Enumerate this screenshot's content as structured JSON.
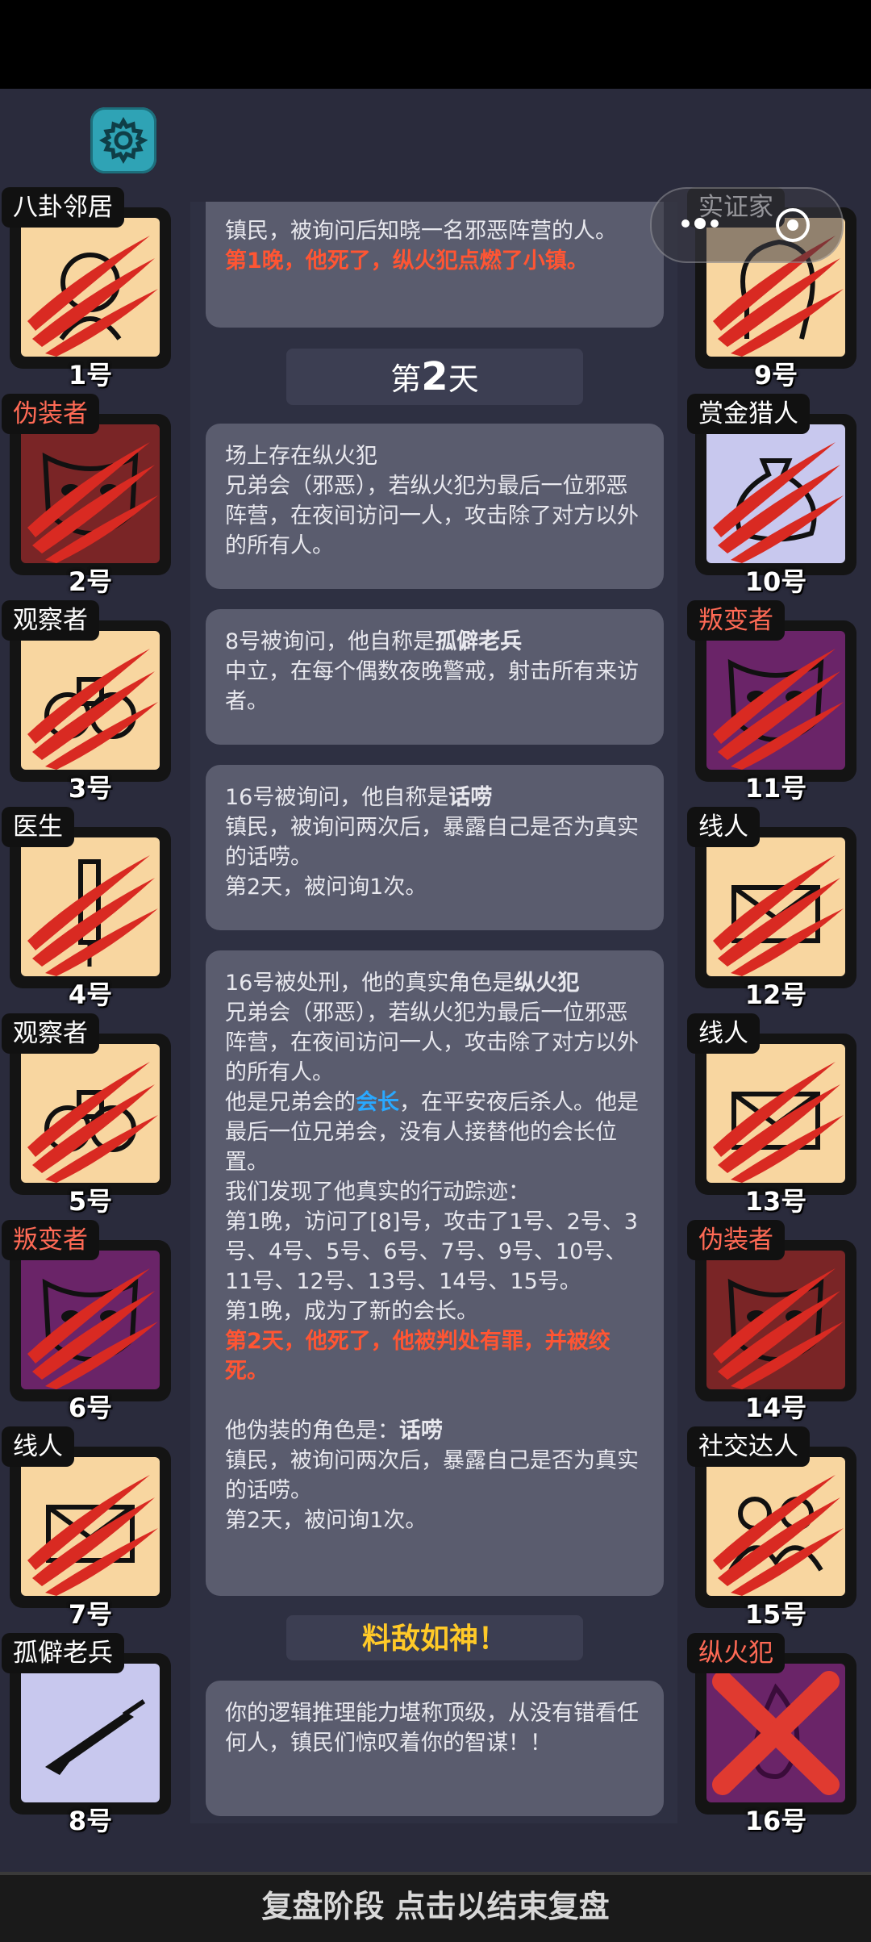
{
  "settings": {
    "icon": "gear-icon"
  },
  "log": {
    "partial_text": "镇民，被询问后知晓一名邪恶阵营的人。",
    "partial_red": "第1晚，他死了，纵火犯点燃了小镇。",
    "day_prefix": "第",
    "day_num": "2",
    "day_suffix": "天",
    "card1": "场上存在纵火犯\n兄弟会（邪恶），若纵火犯为最后一位邪恶阵营，在夜间访问一人，攻击除了对方以外的所有人。",
    "card2_a": "8号被询问，他自称是",
    "card2_b": "孤僻老兵",
    "card2_c": "\n中立，在每个偶数夜晚警戒，射击所有来访者。",
    "card3_a": "16号被询问，他自称是",
    "card3_b": "话唠",
    "card3_c": "\n镇民，被询问两次后，暴露自己是否为真实的话唠。\n第2天，被问询1次。",
    "card4_a": "16号被处刑，他的真实角色是",
    "card4_b": "纵火犯",
    "card4_c": "\n兄弟会（邪恶），若纵火犯为最后一位邪恶阵营，在夜间访问一人，攻击除了对方以外的所有人。\n他是兄弟会的",
    "card4_d": "会长",
    "card4_e": "，在平安夜后杀人。他是最后一位兄弟会，没有人接替他的会长位置。\n我们发现了他真实的行动踪迹：\n第1晚，访问了[8]号，攻击了1号、2号、3号、4号、5号、6号、7号、9号、10号、11号、12号、13号、14号、15号。\n第1晚，成为了新的会长。\n",
    "card4_red": "第2天，他死了，他被判处有罪，并被绞死。",
    "card4_f": "\n\n他伪装的角色是：",
    "card4_g": "话唠",
    "card4_h": "\n镇民，被询问两次后，暴露自己是否为真实的话唠。\n第2天，被问询1次。",
    "rating": "料敌如神！",
    "card5": "你的逻辑推理能力堪称顶级，从没有错看任何人，镇民们惊叹着你的智谋！！"
  },
  "players_left": [
    {
      "role": "八卦邻居",
      "num": "1号",
      "icon": "gossip-icon",
      "bg": "cream",
      "evil": false
    },
    {
      "role": "伪装者",
      "num": "2号",
      "icon": "mask-icon",
      "bg": "maroon",
      "evil": true
    },
    {
      "role": "观察者",
      "num": "3号",
      "icon": "binoculars-icon",
      "bg": "cream",
      "evil": false
    },
    {
      "role": "医生",
      "num": "4号",
      "icon": "syringe-icon",
      "bg": "cream",
      "evil": false
    },
    {
      "role": "观察者",
      "num": "5号",
      "icon": "binoculars-icon",
      "bg": "cream",
      "evil": false
    },
    {
      "role": "叛变者",
      "num": "6号",
      "icon": "theater-mask-icon",
      "bg": "purple",
      "evil": true
    },
    {
      "role": "线人",
      "num": "7号",
      "icon": "envelope-icon",
      "bg": "cream",
      "evil": false
    },
    {
      "role": "孤僻老兵",
      "num": "8号",
      "icon": "rifle-icon",
      "bg": "lavender",
      "evil": false
    }
  ],
  "players_right": [
    {
      "role": "实证家",
      "num": "9号",
      "icon": "head-icon",
      "bg": "cream",
      "evil": false
    },
    {
      "role": "赏金猎人",
      "num": "10号",
      "icon": "money-bag-icon",
      "bg": "lavender",
      "evil": false
    },
    {
      "role": "叛变者",
      "num": "11号",
      "icon": "theater-mask-icon",
      "bg": "purple",
      "evil": true
    },
    {
      "role": "线人",
      "num": "12号",
      "icon": "envelope-icon",
      "bg": "cream",
      "evil": false
    },
    {
      "role": "线人",
      "num": "13号",
      "icon": "envelope-icon",
      "bg": "cream",
      "evil": false
    },
    {
      "role": "伪装者",
      "num": "14号",
      "icon": "mask-icon",
      "bg": "maroon",
      "evil": true
    },
    {
      "role": "社交达人",
      "num": "15号",
      "icon": "people-icon",
      "bg": "cream",
      "evil": false
    },
    {
      "role": "纵火犯",
      "num": "16号",
      "icon": "fire-icon",
      "bg": "purple",
      "evil": true
    }
  ],
  "bottom_button": "复盘阶段 点击以结束复盘"
}
